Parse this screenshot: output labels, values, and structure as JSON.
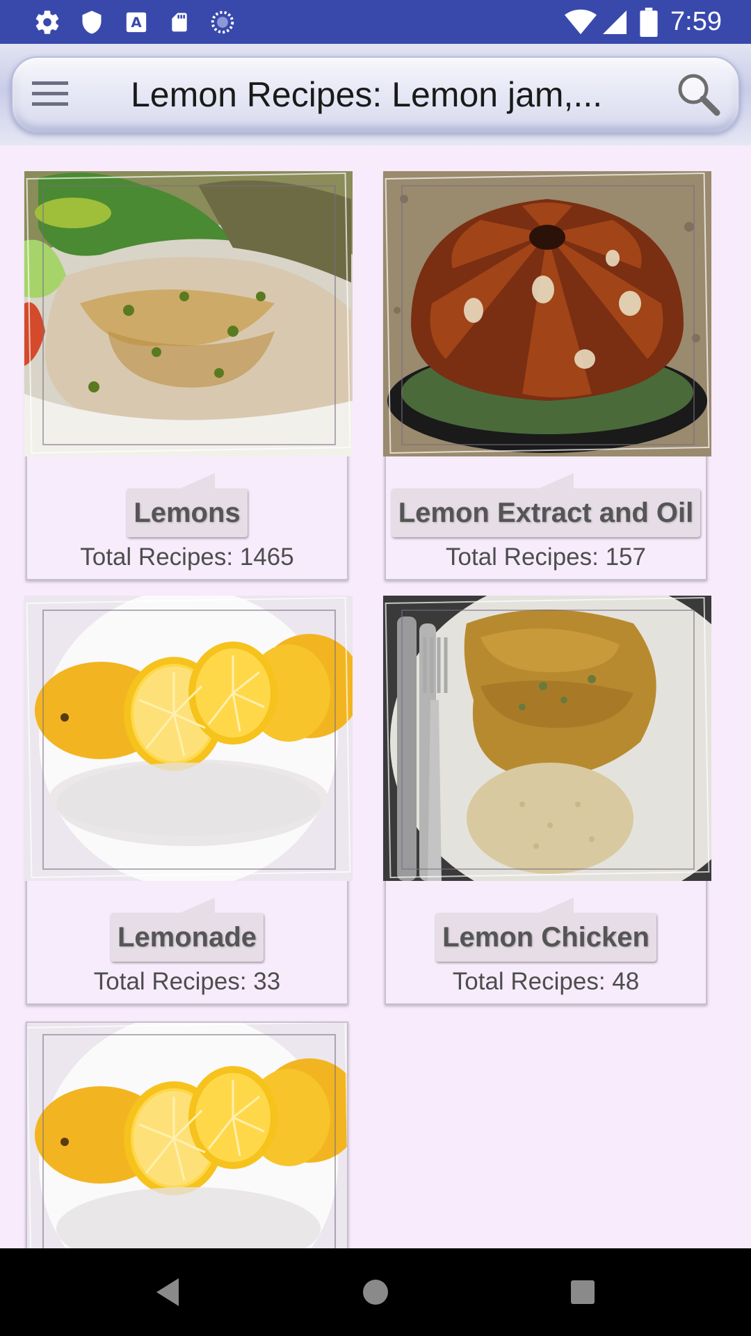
{
  "status_bar": {
    "time": "7:59",
    "icons": [
      "settings-icon",
      "shield-icon",
      "font-a-icon",
      "sd-card-icon",
      "sync-circle-icon",
      "wifi-icon",
      "signal-icon",
      "battery-icon"
    ]
  },
  "app_bar": {
    "title": "Lemon Recipes: Lemon jam,...",
    "menu_icon": "hamburger-menu-icon",
    "search_icon": "search-icon"
  },
  "categories": [
    {
      "name": "Lemons",
      "count": "Total Recipes: 1465",
      "image": "fish-with-capers-photo"
    },
    {
      "name": "Lemon Extract and Oil",
      "count": "Total Recipes: 157",
      "image": "bundt-cake-photo"
    },
    {
      "name": "Lemonade",
      "count": "Total Recipes: 33",
      "image": "lemons-photo"
    },
    {
      "name": "Lemon Chicken",
      "count": "Total Recipes: 48",
      "image": "chicken-rice-plate-photo"
    },
    {
      "name": "",
      "count": "",
      "image": "lemons-photo"
    }
  ],
  "nav_bar": {
    "icons": [
      "back-icon",
      "home-icon",
      "recents-icon"
    ]
  },
  "colors": {
    "status_bar": "#3949ab",
    "background": "#f8ebfc",
    "label_bg": "#e6dde6"
  }
}
